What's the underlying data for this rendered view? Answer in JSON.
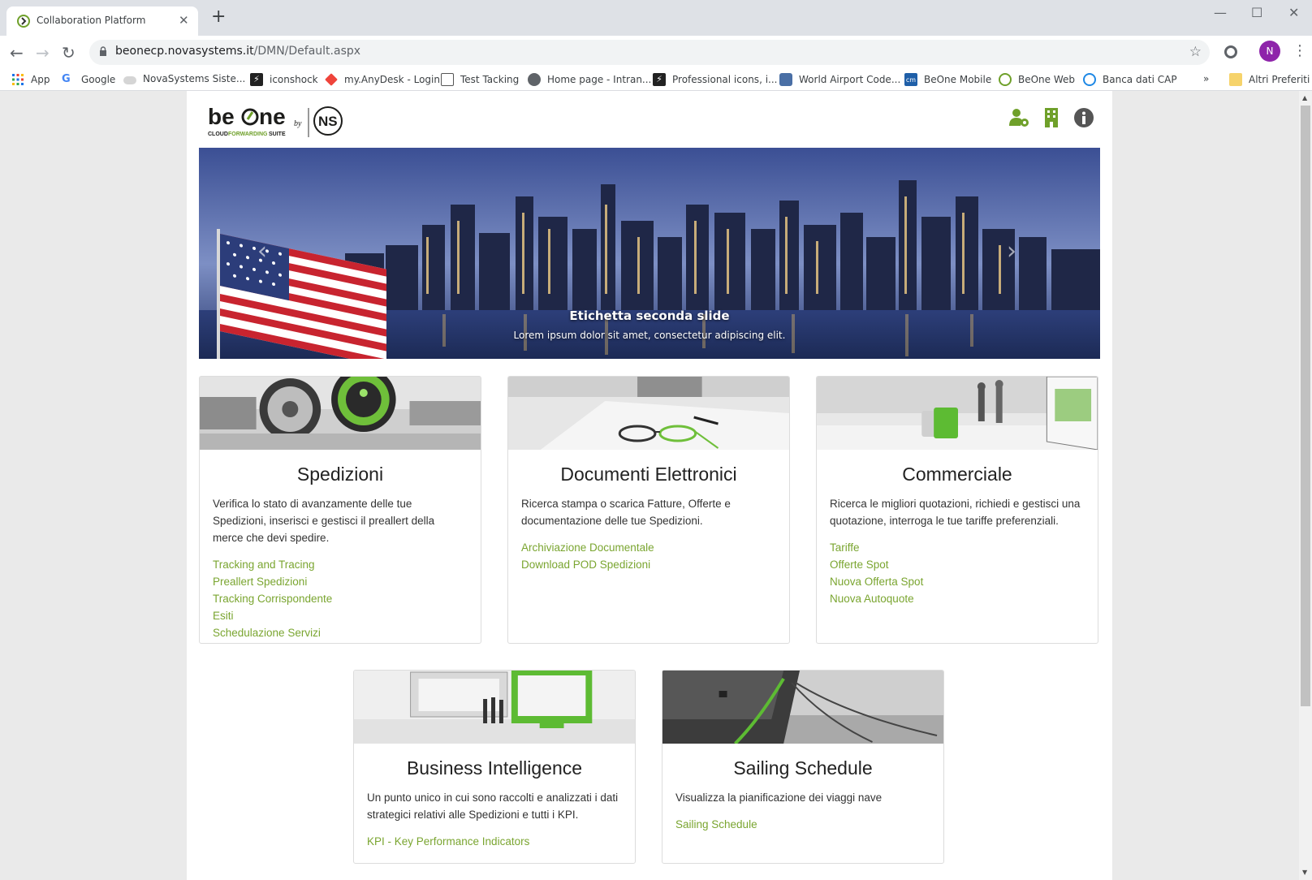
{
  "browser": {
    "tab_title": "Collaboration Platform",
    "url_host": "beonecp.novasystems.it",
    "url_path": "/DMN/Default.aspx",
    "profile_initial": "N",
    "bookmarks": [
      {
        "label": "App",
        "icon": "apps-grid-icon"
      },
      {
        "label": "Google",
        "icon": "google-icon"
      },
      {
        "label": "NovaSystems Siste...",
        "icon": "cloud-icon"
      },
      {
        "label": "iconshock",
        "icon": "iconshock-icon"
      },
      {
        "label": "my.AnyDesk - Login",
        "icon": "anydesk-icon"
      },
      {
        "label": "Test Tacking",
        "icon": "chart-icon"
      },
      {
        "label": "Home page - Intran...",
        "icon": "globe-icon"
      },
      {
        "label": "Professional icons, i...",
        "icon": "bolt-icon"
      },
      {
        "label": "World Airport Code...",
        "icon": "airport-icon"
      },
      {
        "label": "BeOne Mobile",
        "icon": "cm-icon"
      },
      {
        "label": "BeOne Web",
        "icon": "beone-icon"
      },
      {
        "label": "Banca dati CAP",
        "icon": "ie-icon"
      }
    ],
    "other_bookmarks": "Altri Preferiti",
    "overflow": "»"
  },
  "header": {
    "logo_text": "be",
    "logo_text_end": "ne",
    "logo_by": "by",
    "logo_tagline_a": "CLOUD",
    "logo_tagline_b": "FORWARDING",
    "logo_tagline_c": "SUITE",
    "logo_ns": "NS"
  },
  "carousel": {
    "title": "Etichetta seconda slide",
    "text": "Lorem ipsum dolor sit amet, consectetur adipiscing elit.",
    "prev": "‹",
    "next": "›"
  },
  "cards": [
    {
      "title": "Spedizioni",
      "description": "Verifica lo stato di avanzamente delle tue Spedizioni, inserisci e gestisci il preallert della merce che devi spedire.",
      "links": [
        "Tracking and Tracing",
        "Preallert Spedizioni",
        "Tracking Corrispondente",
        "Esiti",
        "Schedulazione Servizi"
      ]
    },
    {
      "title": "Documenti Elettronici",
      "description": "Ricerca stampa o scarica Fatture, Offerte e documentazione delle tue Spedizioni.",
      "links": [
        "Archiviazione Documentale",
        "Download POD Spedizioni"
      ]
    },
    {
      "title": "Commerciale",
      "description": "Ricerca le migliori quotazioni, richiedi e gestisci una quotazione, interroga le tue tariffe preferenziali.",
      "links": [
        "Tariffe",
        "Offerte Spot",
        "Nuova Offerta Spot",
        "Nuova Autoquote"
      ]
    },
    {
      "title": "Business Intelligence",
      "description": "Un punto unico in cui sono raccolti e analizzati i dati strategici relativi alle Spedizioni e tutti i KPI.",
      "links": [
        "KPI - Key Performance Indicators"
      ]
    },
    {
      "title": "Sailing Schedule",
      "description": "Visualizza la pianificazione dei viaggi nave",
      "links": [
        "Sailing Schedule"
      ]
    }
  ],
  "colors": {
    "brand_green": "#7aa530",
    "icon_green": "#6fa02a"
  }
}
